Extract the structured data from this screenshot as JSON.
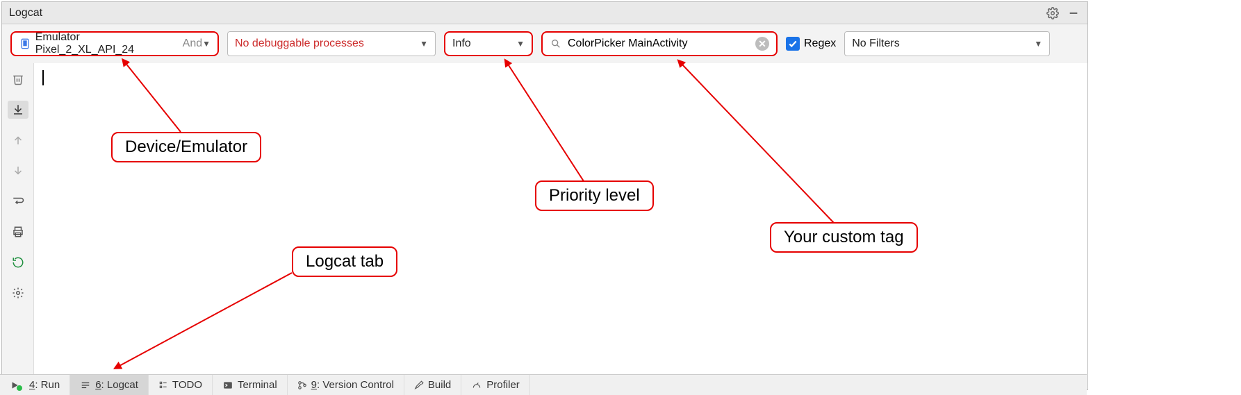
{
  "header": {
    "title": "Logcat"
  },
  "toolbar": {
    "device_selected": "Emulator Pixel_2_XL_API_24",
    "device_trunc": "And",
    "process_selected": "No debuggable processes",
    "level_selected": "Info",
    "search_value": "ColorPicker MainActivity",
    "regex_label": "Regex",
    "filter_selected": "No Filters"
  },
  "annotations": {
    "device": "Device/Emulator",
    "priority": "Priority level",
    "tag": "Your custom tag",
    "logcat_tab": "Logcat tab"
  },
  "tabs": {
    "run_num": "4",
    "run_label": ": Run",
    "logcat_num": "6",
    "logcat_label": ": Logcat",
    "todo": "TODO",
    "terminal": "Terminal",
    "vc_num": "9",
    "vc_label": ": Version Control",
    "build": "Build",
    "profiler": "Profiler"
  }
}
